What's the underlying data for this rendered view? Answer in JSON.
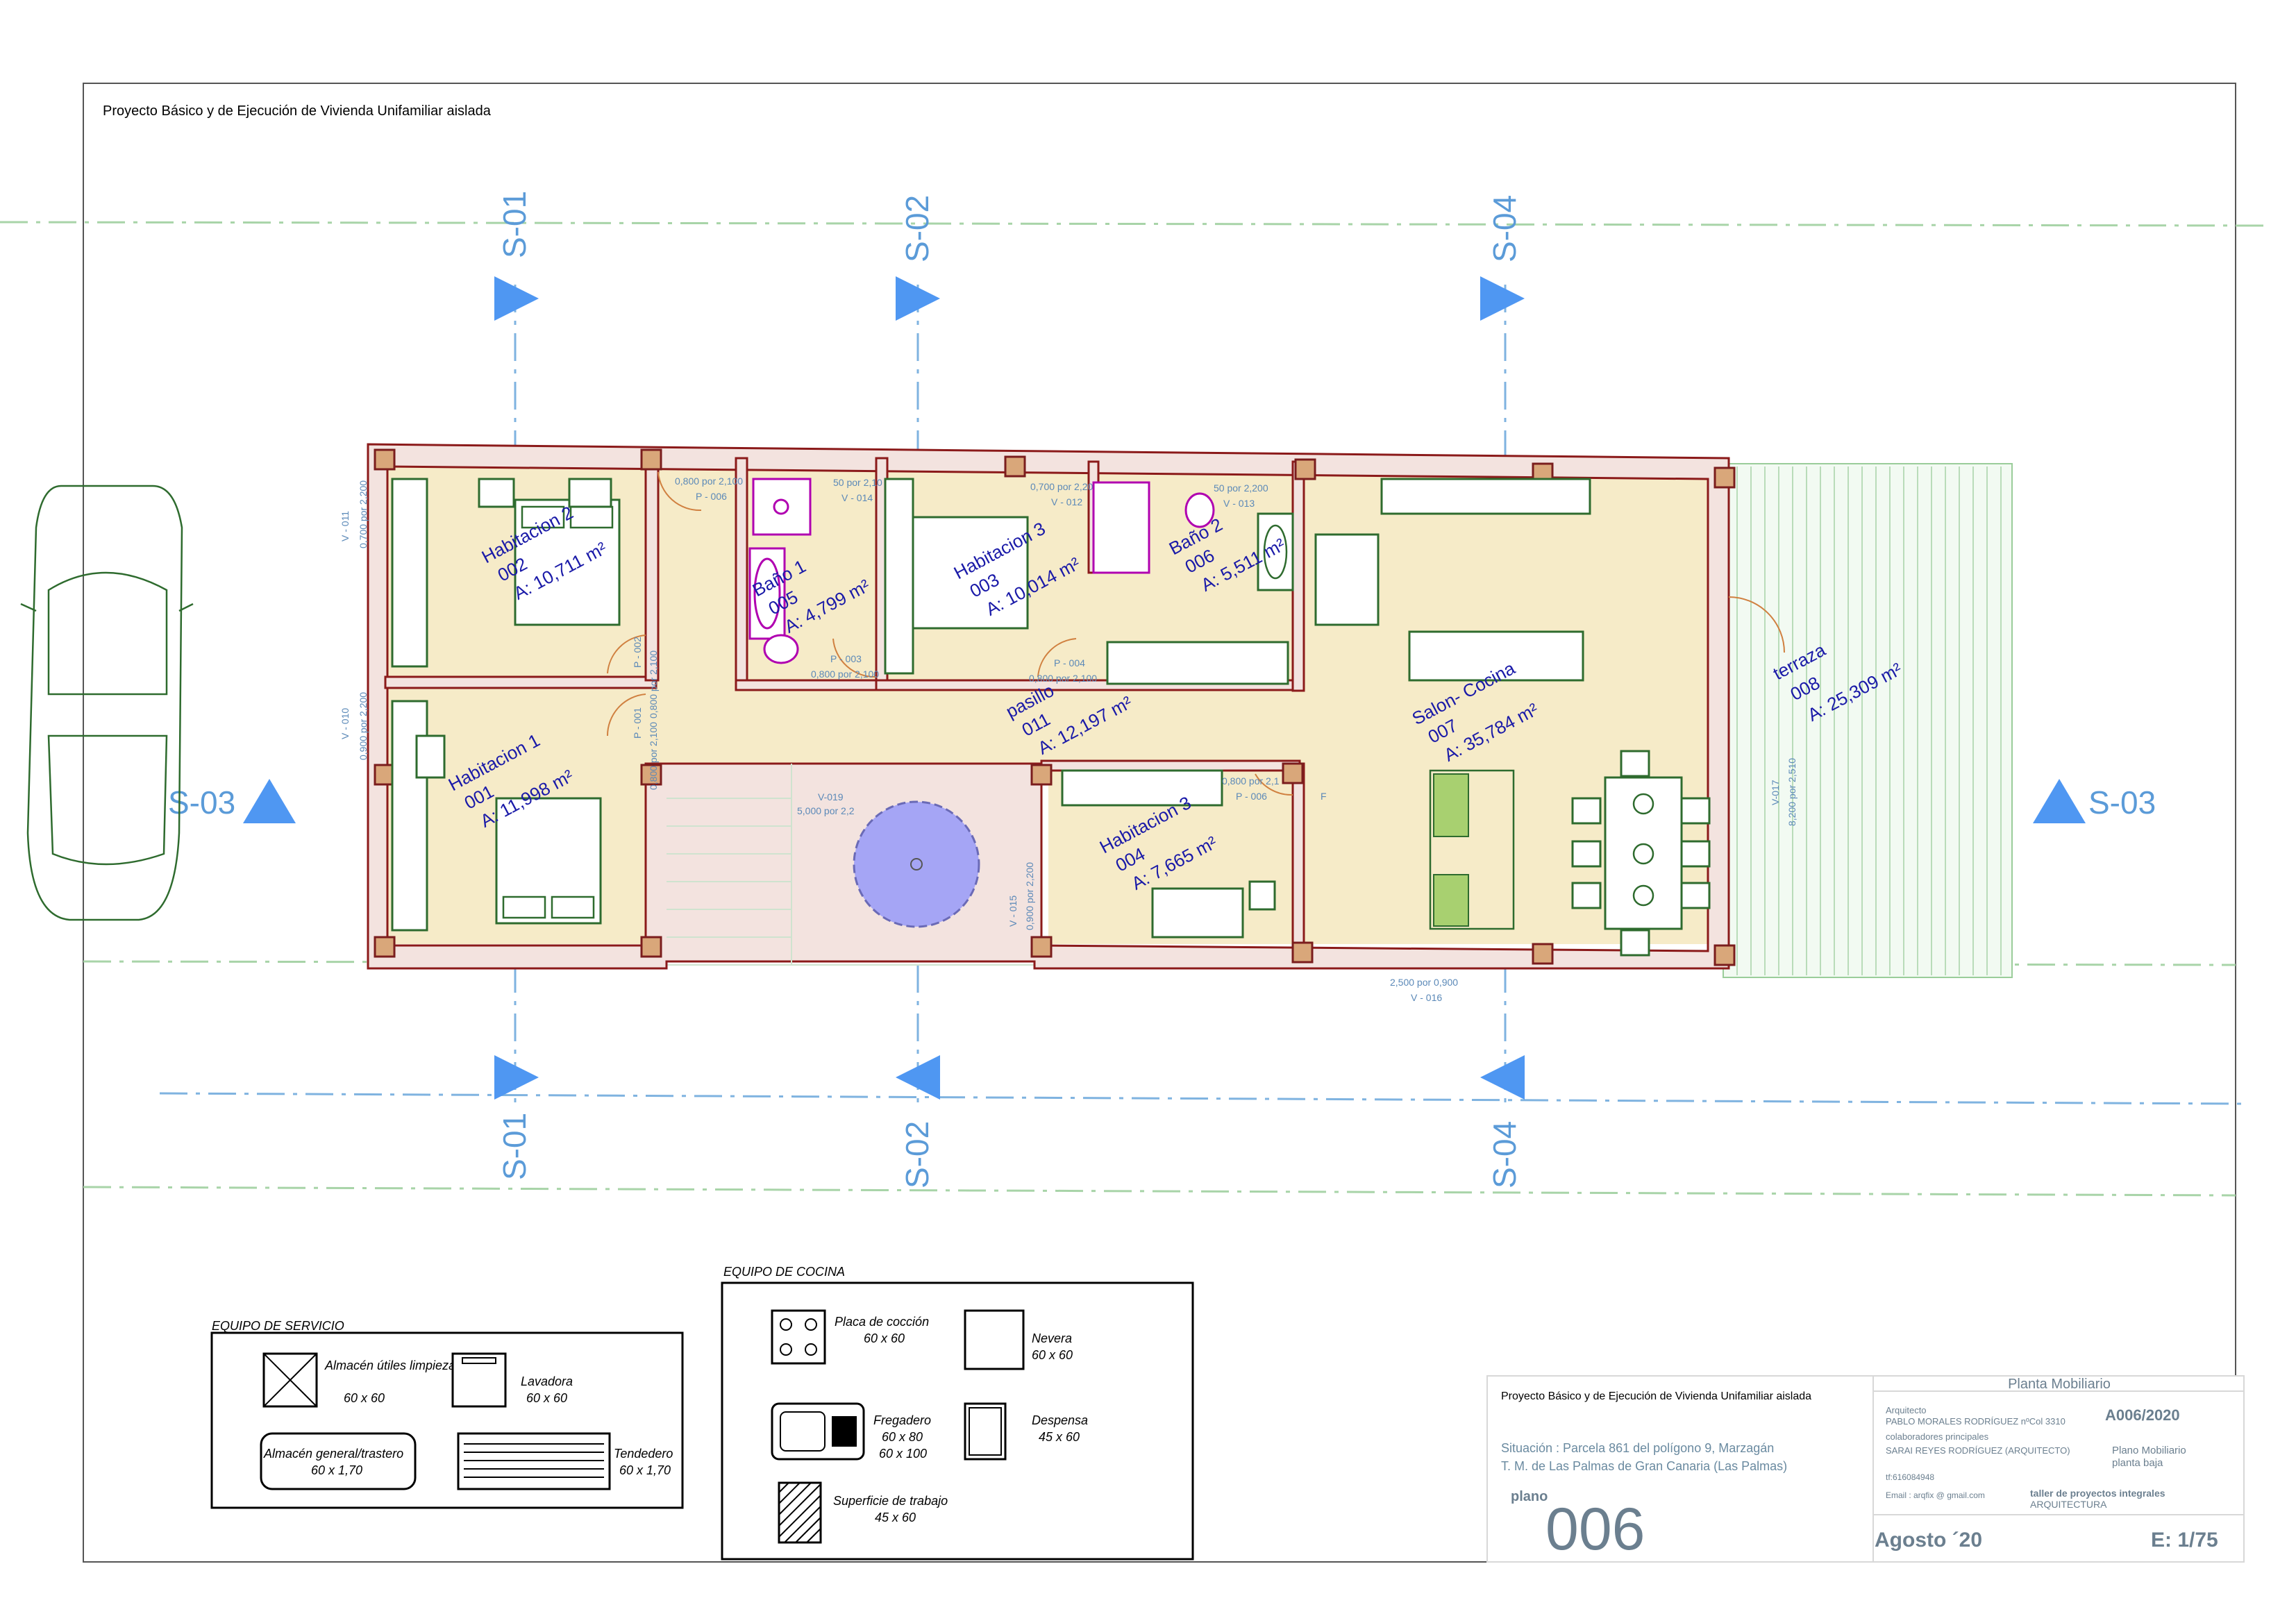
{
  "project_title": "Proyecto Básico y de Ejecución de Vivienda Unifamiliar aislada",
  "sections": {
    "s01": "S-01",
    "s02": "S-02",
    "s03": "S-03",
    "s04": "S-04"
  },
  "rooms": [
    {
      "name": "Habitacion 2",
      "code": "002",
      "area": "A: 10,711 m²"
    },
    {
      "name": "Baño 1",
      "code": "005",
      "area": "A: 4,799 m²"
    },
    {
      "name": "Habitacion 3",
      "code": "003",
      "area": "A: 10,014 m²"
    },
    {
      "name": "Baño 2",
      "code": "006",
      "area": "A: 5,511 m²"
    },
    {
      "name": "Habitacion 1",
      "code": "001",
      "area": "A: 11,998 m²"
    },
    {
      "name": "pasillo",
      "code": "011",
      "area": "A: 12,197 m²"
    },
    {
      "name": "Habitacion 3",
      "code": "004",
      "area": "A: 7,665 m²"
    },
    {
      "name": "Salon- Cocina",
      "code": "007",
      "area": "A: 35,784 m²"
    },
    {
      "name": "terraza",
      "code": "008",
      "area": "A: 25,309 m²"
    }
  ],
  "openings": {
    "v011": "V - 011",
    "v011_dim": "0,700 por 2,200",
    "v010": "V - 010",
    "v010_dim": "0,900 por 2,200",
    "p006a_dim": "0,800 por 2,100",
    "p006a": "P - 006",
    "v014_dim": "50 por 2,10",
    "v014": "V - 014",
    "v012_dim": "0,700 por 2,20",
    "v012": "V - 012",
    "v013_dim": "50 por 2,200",
    "v013": "V - 013",
    "p002": "P - 002",
    "p002_dim": "0,800 por 2,100",
    "p003": "P - 003",
    "p003_dim": "0,800 por 2,100",
    "p004": "P - 004",
    "p004_dim": "0,800 por 2,100",
    "p001": "P - 001",
    "p001_dim": "0,800 por 2,100",
    "v019": "V-019",
    "v019_dim": "5,000 por 2,2",
    "v015": "V - 015",
    "v015_dim": "0,900 por 2,200",
    "p006b_dim": "0,800 por 2,1",
    "p006b": "P - 006",
    "v016_dim": "2,500 por 0,900",
    "v016": "V - 016",
    "v017": "V-017",
    "v017_dim": "8,200 por 2,510",
    "f_mark": "F"
  },
  "legend_service": {
    "title": "EQUIPO DE SERVICIO",
    "items": [
      {
        "label": "Almacén útiles limpieza",
        "size": "60 x 60"
      },
      {
        "label": "Lavadora",
        "size": "60 x 60"
      },
      {
        "label": "Almacén general/trastero",
        "size": "60 x 1,70"
      },
      {
        "label": "Tendedero",
        "size": "60 x 1,70"
      }
    ]
  },
  "legend_kitchen": {
    "title": "EQUIPO DE COCINA",
    "items": [
      {
        "label": "Placa de cocción",
        "size": "60 x 60"
      },
      {
        "label": "Nevera",
        "size": "60 x 60"
      },
      {
        "label": "Fregadero",
        "size": "60 x 80",
        "size2": "60 x 100"
      },
      {
        "label": "Despensa",
        "size": "45 x 60"
      },
      {
        "label": "Superficie de trabajo",
        "size": "45 x 60"
      }
    ]
  },
  "title_block": {
    "header": "Planta Mobiliario",
    "project": "Proyecto Básico y de Ejecución de Vivienda Unifamiliar aislada",
    "situacion": "Situación : Parcela 861 del polígono 9, Marzagán",
    "municipio": "T. M. de Las Palmas de Gran Canaria (Las Palmas)",
    "arq_label": "Arquitecto",
    "arq_name": "PABLO MORALES RODRÍGUEZ nºCol 3310",
    "colab_label": "colaboradores   principales",
    "colab_name": "SARAI REYES RODRÍGUEZ (ARQUITECTO)",
    "tel": "tf:616084948",
    "email": "Email : arqfix @ gmail.com",
    "ref": "A006/2020",
    "desc1": "Plano Mobiliario",
    "desc2": "planta baja",
    "studio1": "taller de proyectos integrales",
    "studio2": "ARQUITECTURA",
    "plano_label": "plano",
    "plano_num": "006",
    "date": "Agosto ´20",
    "scale": "E: 1/75"
  }
}
